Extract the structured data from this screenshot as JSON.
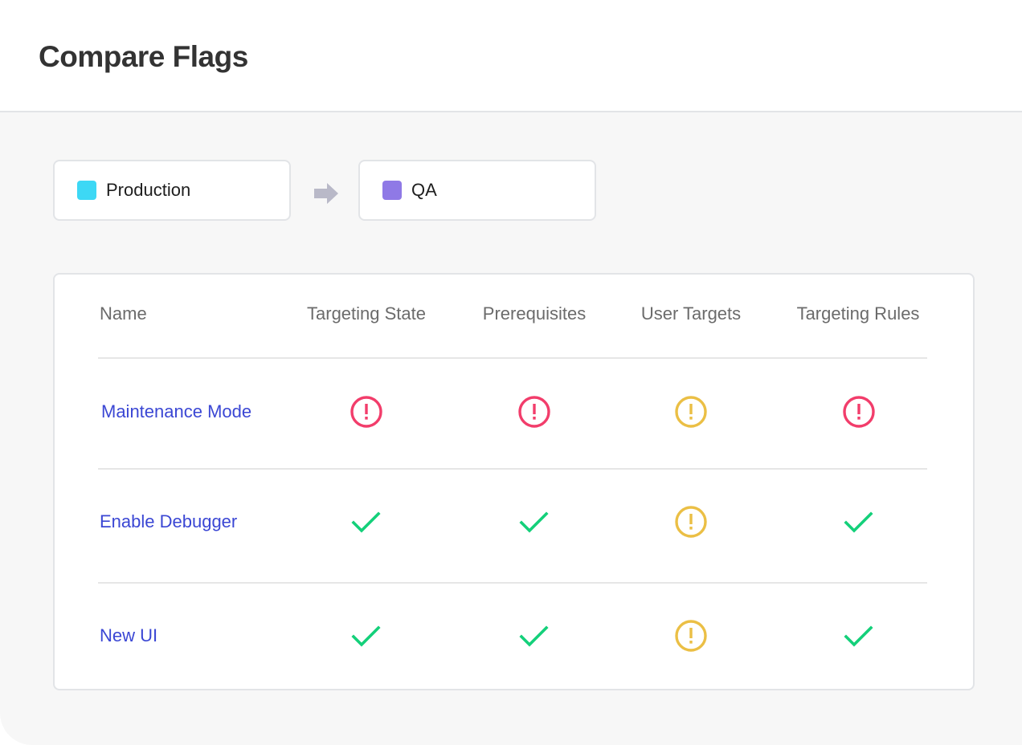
{
  "header": {
    "title": "Compare Flags"
  },
  "environments": {
    "source": {
      "name": "Production",
      "color": "#3dd8f5"
    },
    "arrow_icon": "arrow-right-icon",
    "target": {
      "name": "QA",
      "color": "#8f79e6"
    }
  },
  "table": {
    "columns": [
      "Name",
      "Targeting State",
      "Prerequisites",
      "User Targets",
      "Targeting Rules"
    ],
    "rows": [
      {
        "name": "Maintenance Mode",
        "statuses": [
          "error",
          "error",
          "warning",
          "error"
        ]
      },
      {
        "name": "Enable Debugger",
        "statuses": [
          "match",
          "match",
          "warning",
          "match"
        ]
      },
      {
        "name": "New UI",
        "statuses": [
          "match",
          "match",
          "warning",
          "match"
        ]
      }
    ]
  },
  "status_legend": {
    "error": {
      "icon": "alert-circle-icon",
      "color": "#f23d6b"
    },
    "warning": {
      "icon": "alert-circle-icon",
      "color": "#ebbf45"
    },
    "match": {
      "icon": "checkmark-icon",
      "color": "#14d07a"
    }
  }
}
